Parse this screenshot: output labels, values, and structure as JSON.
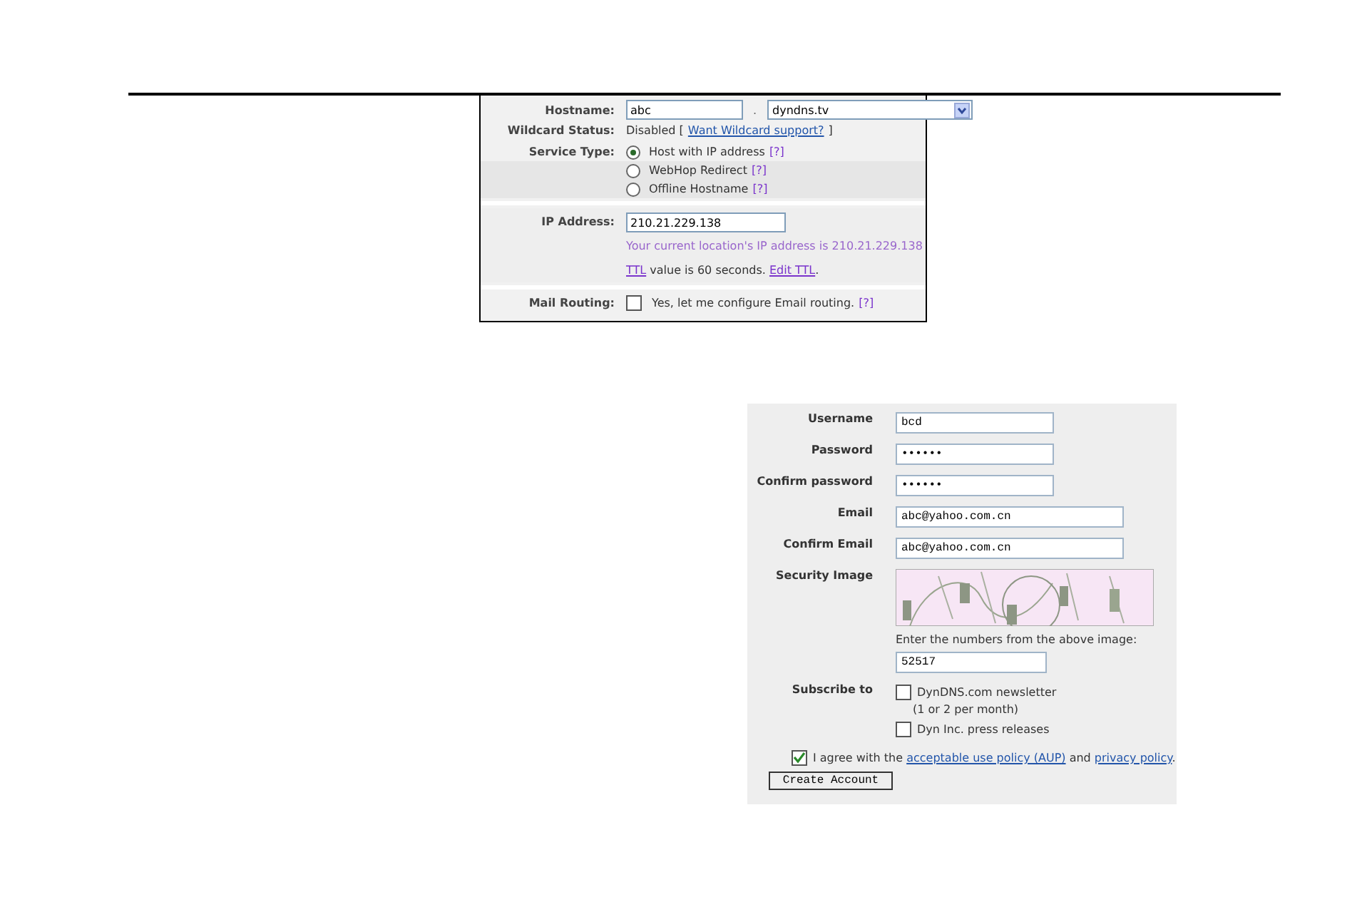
{
  "hostname_form": {
    "hostname": {
      "label": "Hostname:",
      "value": "abc",
      "separator": ".",
      "domain": "dyndns.tv"
    },
    "wildcard": {
      "label": "Wildcard Status:",
      "before": "Disabled [",
      "link": "Want Wildcard support?",
      "after": "]"
    },
    "service_type": {
      "label": "Service Type:",
      "options": [
        {
          "label": "Host with IP address",
          "help": "[?]",
          "selected": true
        },
        {
          "label": "WebHop Redirect",
          "help": "[?]",
          "selected": false
        },
        {
          "label": "Offline Hostname",
          "help": "[?]",
          "selected": false
        }
      ]
    },
    "ip_address": {
      "label": "IP Address:",
      "value": "210.21.229.138",
      "note": "Your current location's IP address is 210.21.229.138",
      "ttl_link": "TTL",
      "ttl_text": " value is 60 seconds. ",
      "edit_link": "Edit TTL",
      "ttl_end": "."
    },
    "mail_routing": {
      "label": "Mail Routing:",
      "checked": false,
      "text": "Yes, let me configure Email routing.",
      "help": "[?]"
    }
  },
  "account_form": {
    "fields": [
      {
        "label": "Username",
        "value": "bcd",
        "kind": "short"
      },
      {
        "label": "Password",
        "value": "••••••",
        "kind": "short"
      },
      {
        "label": "Confirm password",
        "value": "••••••",
        "kind": "short"
      },
      {
        "label": "Email",
        "value": "abc@yahoo.com.cn",
        "kind": "long"
      },
      {
        "label": "Confirm Email",
        "value": "abc@yahoo.com.cn",
        "kind": "long"
      }
    ],
    "security": {
      "label": "Security Image",
      "kind": "picture",
      "instruction": "Enter the numbers from the above image:",
      "value": "52517"
    },
    "subscribe": {
      "label": "Subscribe to",
      "options": [
        {
          "label": "DynDNS.com newsletter",
          "note": "(1 or 2 per month)",
          "checked": false
        },
        {
          "label": "Dyn Inc. press releases",
          "checked": false
        }
      ]
    },
    "agree": {
      "checked": true,
      "before": "I agree with the ",
      "link1": "acceptable use policy (AUP)",
      "middle": " and ",
      "link2": "privacy policy",
      "after": "."
    },
    "button": "Create Account"
  }
}
